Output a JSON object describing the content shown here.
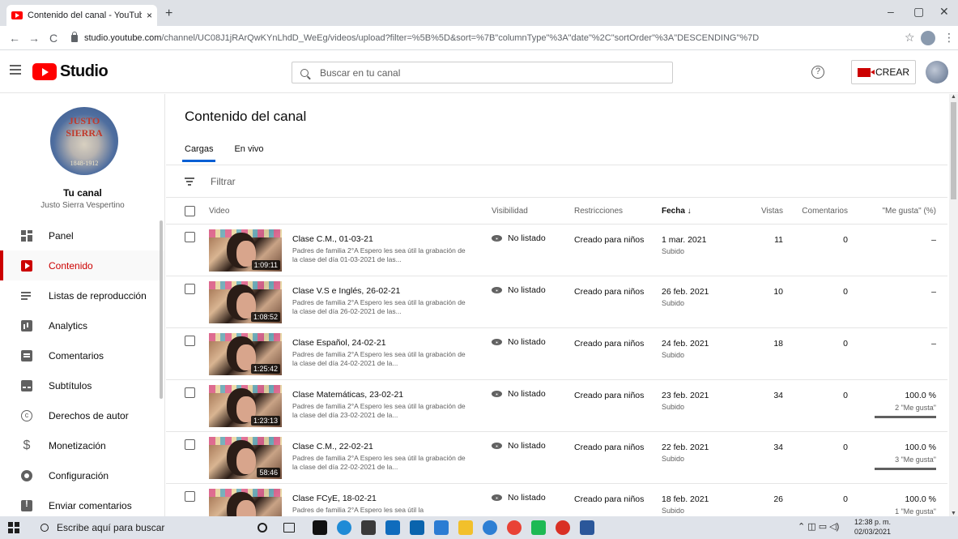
{
  "browser": {
    "tab_title": "Contenido del canal - YouTube S",
    "tab_close": "×",
    "new_tab": "+",
    "url_host": "studio.youtube.com",
    "url_path": "/channel/UC08J1jRArQwKYnLhdD_WeEg/videos/upload?filter=%5B%5D&sort=%7B\"columnType\"%3A\"date\"%2C\"sortOrder\"%3A\"DESCENDING\"%7D",
    "back": "←",
    "forward": "→",
    "reload": "C",
    "star": "☆",
    "menu": "⋮",
    "minimize": "–",
    "maximize": "▢",
    "close": "✕"
  },
  "header": {
    "logo_text": "Studio",
    "search_placeholder": "Buscar en tu canal",
    "help": "?",
    "create_label": "CREAR"
  },
  "sidebar": {
    "avatar_text": "JUSTO SIERRA",
    "avatar_years": "1848-1912",
    "tu_canal": "Tu canal",
    "channel_name": "Justo Sierra Vespertino",
    "items": [
      {
        "label": "Panel",
        "icon": "dashboard-icon"
      },
      {
        "label": "Contenido",
        "icon": "content-icon",
        "active": true
      },
      {
        "label": "Listas de reproducción",
        "icon": "playlists-icon"
      },
      {
        "label": "Analytics",
        "icon": "analytics-icon"
      },
      {
        "label": "Comentarios",
        "icon": "comments-icon"
      },
      {
        "label": "Subtítulos",
        "icon": "subtitles-icon"
      },
      {
        "label": "Derechos de autor",
        "icon": "copyright-icon"
      },
      {
        "label": "Monetización",
        "icon": "monetization-icon"
      },
      {
        "label": "Configuración",
        "icon": "settings-icon"
      },
      {
        "label": "Enviar comentarios",
        "icon": "feedback-icon"
      }
    ]
  },
  "main": {
    "page_title": "Contenido del canal",
    "tabs": [
      {
        "label": "Cargas",
        "active": true
      },
      {
        "label": "En vivo"
      }
    ],
    "filter_label": "Filtrar",
    "columns": {
      "video": "Video",
      "visibility": "Visibilidad",
      "restrictions": "Restricciones",
      "date": "Fecha ↓",
      "views": "Vistas",
      "comments": "Comentarios",
      "likes": "\"Me gusta\" (%)"
    },
    "rows": [
      {
        "title": "Clase C.M., 01-03-21",
        "desc": "Padres de familia 2°A Espero les sea útil la grabación de la clase del día 01-03-2021 de las...",
        "duration": "1:09:11",
        "visibility": "No listado",
        "restrictions": "Creado para niños",
        "date": "1 mar. 2021",
        "date_sub": "Subido",
        "views": "11",
        "comments": "0",
        "likes": "–",
        "likes_sub": ""
      },
      {
        "title": "Clase V.S e Inglés, 26-02-21",
        "desc": "Padres de familia 2°A Espero les sea útil la grabación de la clase del día 26-02-2021 de las...",
        "duration": "1:08:52",
        "visibility": "No listado",
        "restrictions": "Creado para niños",
        "date": "26 feb. 2021",
        "date_sub": "Subido",
        "views": "10",
        "comments": "0",
        "likes": "–",
        "likes_sub": ""
      },
      {
        "title": "Clase Español, 24-02-21",
        "desc": "Padres de familia 2°A Espero les sea útil la grabación de la clase del día 24-02-2021 de la...",
        "duration": "1:25:42",
        "visibility": "No listado",
        "restrictions": "Creado para niños",
        "date": "24 feb. 2021",
        "date_sub": "Subido",
        "views": "18",
        "comments": "0",
        "likes": "–",
        "likes_sub": ""
      },
      {
        "title": "Clase Matemáticas, 23-02-21",
        "desc": "Padres de familia 2°A Espero les sea útil la grabación de la clase del día 23-02-2021 de la...",
        "duration": "1:23:13",
        "visibility": "No listado",
        "restrictions": "Creado para niños",
        "date": "23 feb. 2021",
        "date_sub": "Subido",
        "views": "34",
        "comments": "0",
        "likes": "100.0 %",
        "likes_sub": "2 \"Me gusta\""
      },
      {
        "title": "Clase C.M., 22-02-21",
        "desc": "Padres de familia 2°A Espero les sea útil la grabación de la clase del día 22-02-2021 de la...",
        "duration": "58:46",
        "visibility": "No listado",
        "restrictions": "Creado para niños",
        "date": "22 feb. 2021",
        "date_sub": "Subido",
        "views": "34",
        "comments": "0",
        "likes": "100.0 %",
        "likes_sub": "3 \"Me gusta\""
      },
      {
        "title": "Clase FCyE, 18-02-21",
        "desc": "Padres de familia 2°A Espero les sea útil la",
        "duration": "",
        "visibility": "No listado",
        "restrictions": "Creado para niños",
        "date": "18 feb. 2021",
        "date_sub": "Subido",
        "views": "26",
        "comments": "0",
        "likes": "100.0 %",
        "likes_sub": "1 \"Me gusta\""
      }
    ]
  },
  "taskbar": {
    "search_text": "Escribe aquí para buscar",
    "time": "12:38 p. m.",
    "date": "02/03/2021"
  },
  "colors": {
    "accent_red": "#cc0000",
    "youtube_red": "#ff0000",
    "tab_blue": "#065fd4"
  }
}
